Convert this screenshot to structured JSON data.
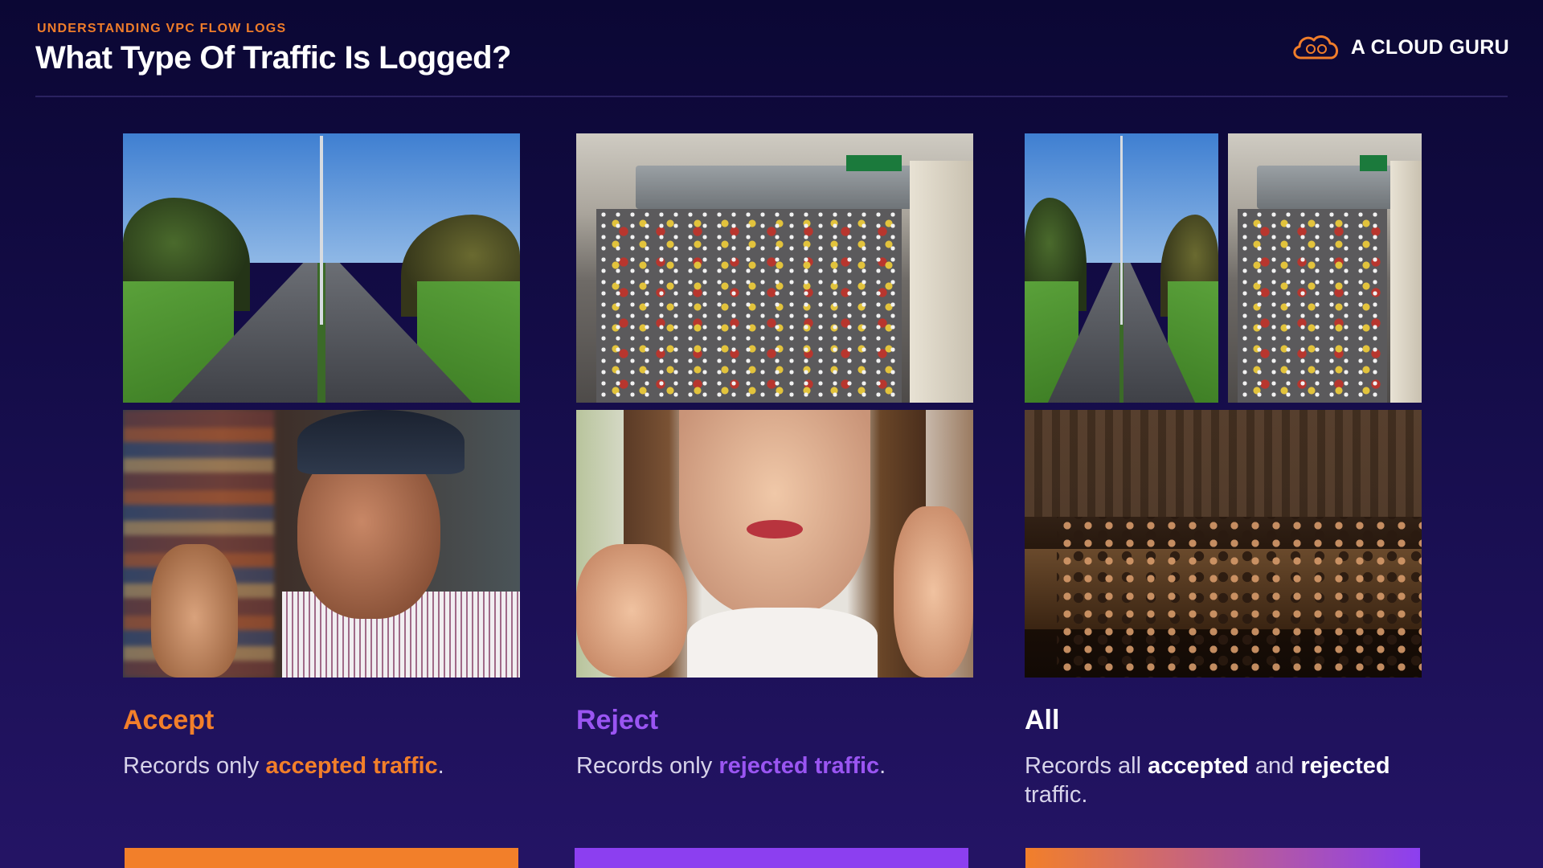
{
  "header": {
    "eyebrow": "UNDERSTANDING VPC FLOW LOGS",
    "title": "What Type Of Traffic Is Logged?",
    "brand": "A CLOUD GURU",
    "brand_icon": "cloud-logo-icon",
    "brand_color": "#f07d2a"
  },
  "columns": [
    {
      "heading": "Accept",
      "desc_prefix": "Records only ",
      "desc_highlight": "accepted traffic",
      "desc_suffix": ".",
      "accent": "#f27f2a"
    },
    {
      "heading": "Reject",
      "desc_prefix": "Records only ",
      "desc_highlight": "rejected traffic",
      "desc_suffix": ".",
      "accent": "#8c3ff0"
    },
    {
      "heading": "All",
      "desc_prefix": "Records all ",
      "desc_highlight_1": "accepted",
      "desc_mid": " and ",
      "desc_highlight_2": "rejected",
      "desc_suffix": " traffic.",
      "accent": "#ffffff"
    }
  ]
}
